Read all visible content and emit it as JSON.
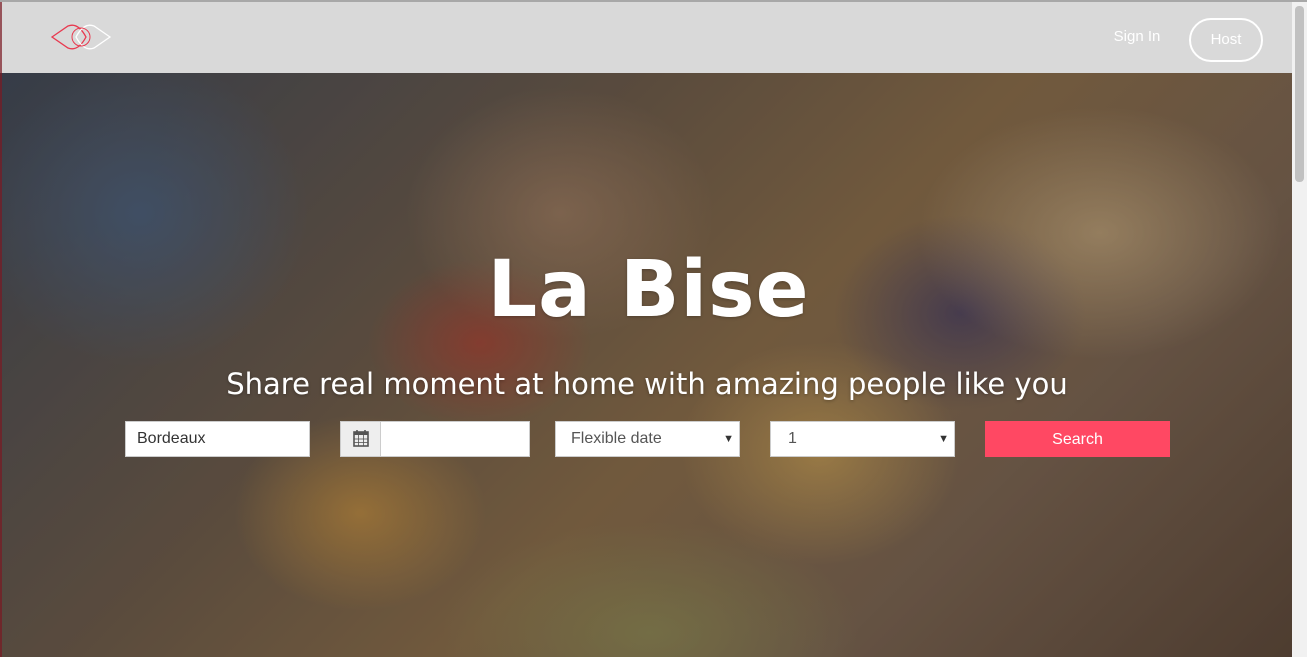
{
  "header": {
    "signin_label": "Sign In",
    "host_label": "Host"
  },
  "hero": {
    "title": "La Bise",
    "subtitle": "Share real moment at home with amazing people like you"
  },
  "search": {
    "city_value": "Bordeaux",
    "date_value": "",
    "calendar_icon": "calendar-icon",
    "flexibility_selected": "Flexible date",
    "guests_selected": "1",
    "search_label": "Search"
  },
  "colors": {
    "accent": "#ff4863",
    "header_bg": "#d9d9d9",
    "logo_red": "#e8394f"
  }
}
